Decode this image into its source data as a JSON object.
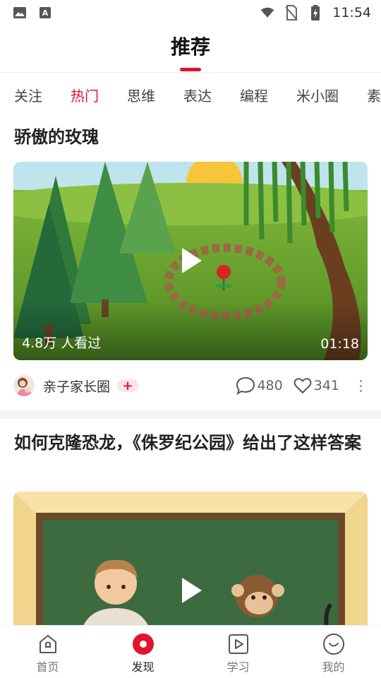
{
  "status_bar": {
    "time": "11:54",
    "icons": [
      "image-icon",
      "keyboard-a-icon",
      "wifi-icon",
      "no-sim-icon",
      "battery-charging-icon"
    ]
  },
  "header": {
    "title": "推荐"
  },
  "tabs": [
    {
      "label": "关注",
      "active": false
    },
    {
      "label": "热门",
      "active": true
    },
    {
      "label": "思维",
      "active": false
    },
    {
      "label": "表达",
      "active": false
    },
    {
      "label": "编程",
      "active": false
    },
    {
      "label": "米小圈",
      "active": false
    },
    {
      "label": "素",
      "active": false
    }
  ],
  "feed": [
    {
      "title": "骄傲的玫瑰",
      "views": "4.8万 人看过",
      "duration": "01:18",
      "channel": "亲子家长圈",
      "badge": "+",
      "comments": "480",
      "likes": "341"
    },
    {
      "title": "如何克隆恐龙，《侏罗纪公园》给出了这样答案"
    }
  ],
  "bottom_nav": [
    {
      "label": "首页",
      "icon": "home-icon",
      "active": false
    },
    {
      "label": "发现",
      "icon": "discover-icon",
      "active": true
    },
    {
      "label": "学习",
      "icon": "play-square-icon",
      "active": false
    },
    {
      "label": "我的",
      "icon": "smile-face-icon",
      "active": false
    }
  ],
  "colors": {
    "accent": "#e1142b",
    "text": "#222222",
    "muted": "#777777"
  }
}
